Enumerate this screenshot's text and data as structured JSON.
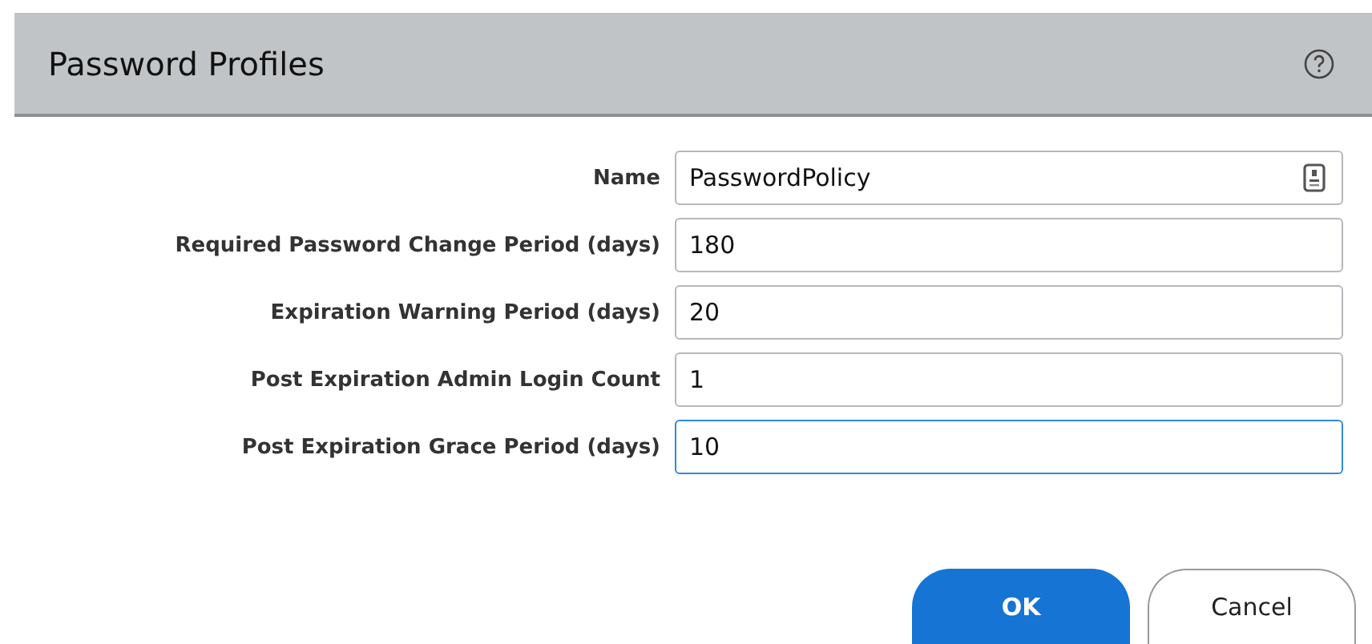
{
  "window": {
    "title": "Password Profiles"
  },
  "fields": [
    {
      "label": "Name",
      "value": "PasswordPolicy",
      "focused": false,
      "has_icon": true
    },
    {
      "label": "Required Password Change Period (days)",
      "value": "180",
      "focused": false,
      "has_icon": false
    },
    {
      "label": "Expiration Warning Period (days)",
      "value": "20",
      "focused": false,
      "has_icon": false
    },
    {
      "label": "Post Expiration Admin Login Count",
      "value": "1",
      "focused": false,
      "has_icon": false
    },
    {
      "label": "Post Expiration Grace Period (days)",
      "value": "10",
      "focused": true,
      "has_icon": false
    }
  ],
  "buttons": [
    {
      "label": "OK",
      "kind": "primary"
    },
    {
      "label": "Cancel",
      "kind": "secondary"
    }
  ]
}
